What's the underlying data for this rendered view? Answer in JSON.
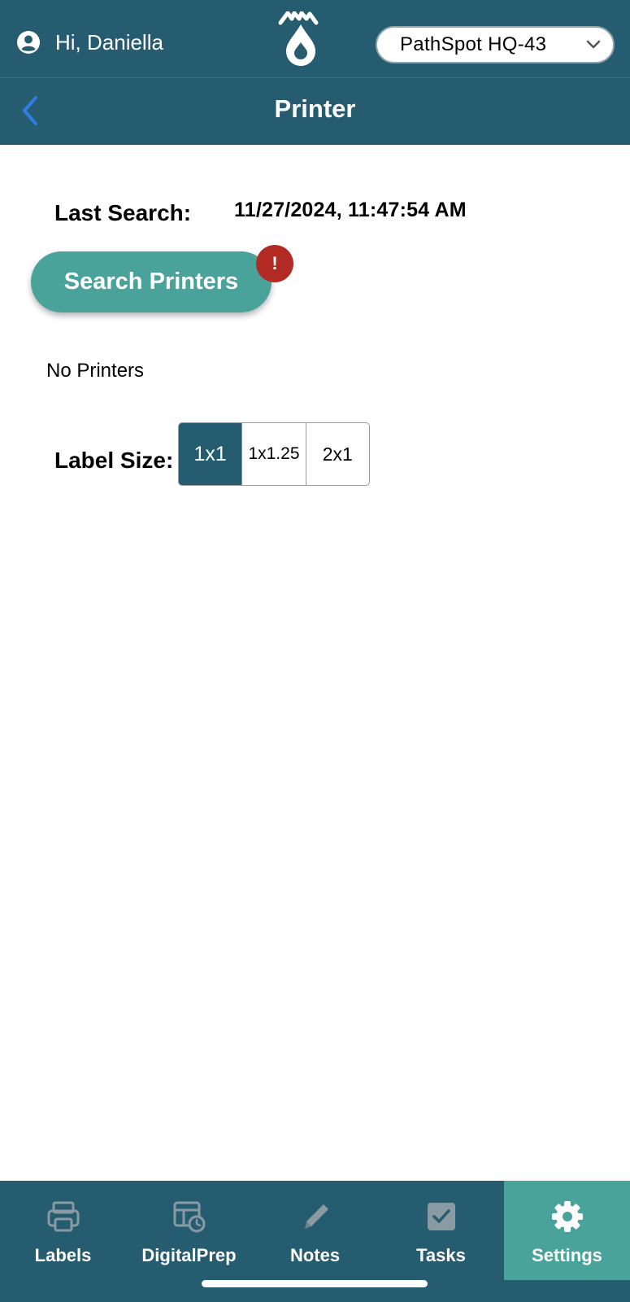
{
  "header": {
    "greeting": "Hi, Daniella",
    "location": "PathSpot HQ-43"
  },
  "navbar": {
    "title": "Printer",
    "back_icon": "chevron-left-icon"
  },
  "content": {
    "last_search_label": "Last Search:",
    "last_search_value": "11/27/2024, 11:47:54 AM",
    "search_button_label": "Search Printers",
    "alert_badge": "!",
    "no_printers_text": "No Printers",
    "label_size_label": "Label Size:",
    "label_sizes": [
      "1x1",
      "1x1.25",
      "2x1"
    ],
    "selected_label_size": "1x1"
  },
  "tabs": [
    {
      "label": "Labels",
      "icon": "printer-icon"
    },
    {
      "label": "DigitalPrep",
      "icon": "digitalprep-icon"
    },
    {
      "label": "Notes",
      "icon": "pencil-icon"
    },
    {
      "label": "Tasks",
      "icon": "checkbox-icon"
    },
    {
      "label": "Settings",
      "icon": "gear-icon"
    }
  ],
  "active_tab": "Settings",
  "colors": {
    "header_bg": "#255c70",
    "accent_teal": "#4aa39a",
    "alert_red": "#b12a23",
    "back_arrow_blue": "#2f7de0",
    "tab_icon_gray": "#8a9aa2"
  }
}
